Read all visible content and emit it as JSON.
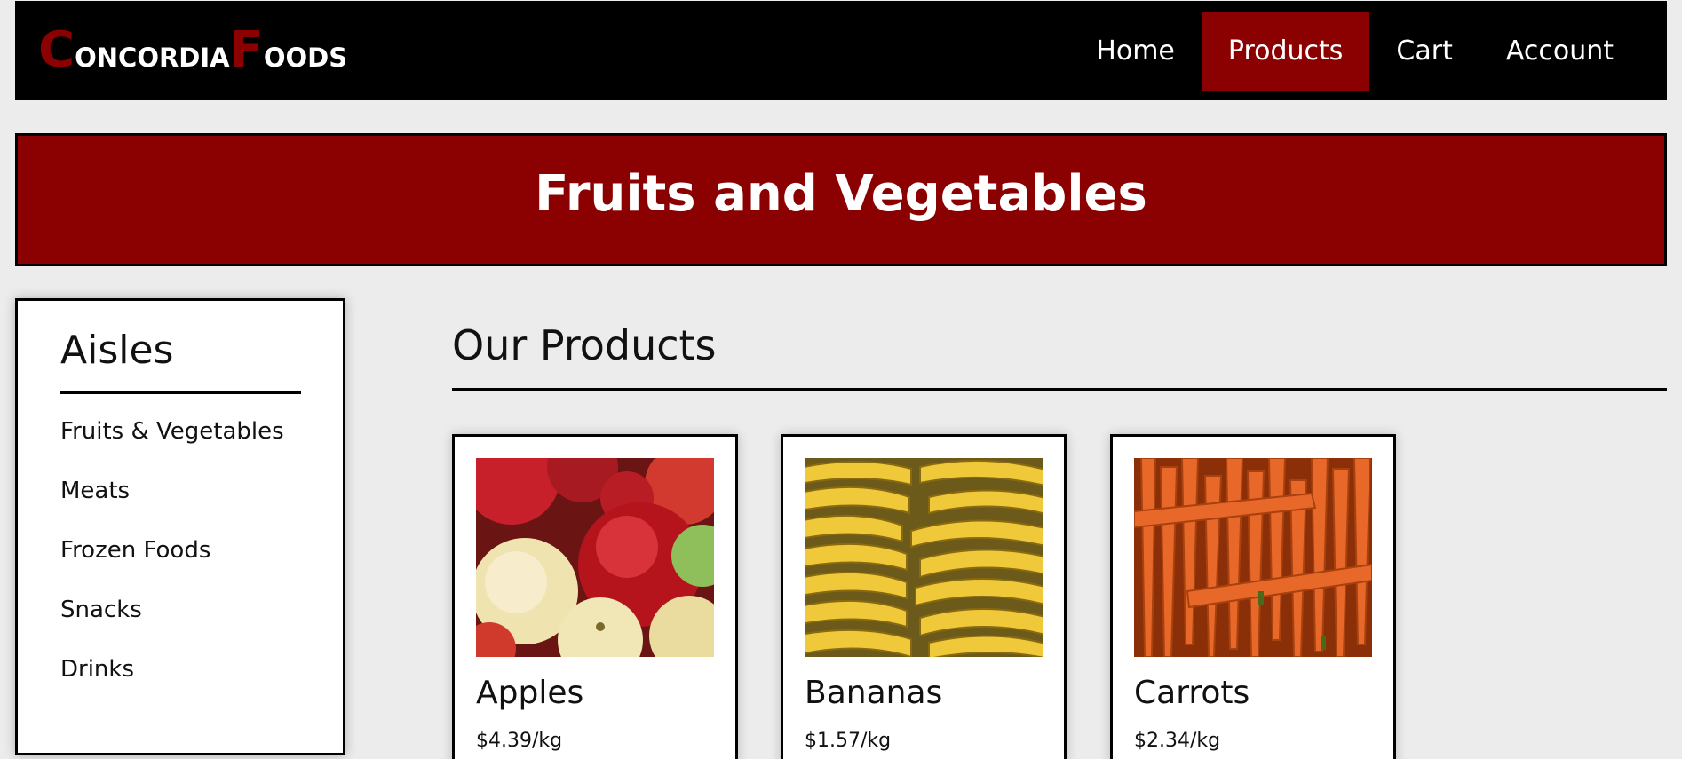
{
  "brand": {
    "parts": [
      {
        "cap": "C",
        "rest": "ONCORDIA"
      },
      {
        "cap": "F",
        "rest": "OODS"
      }
    ],
    "accent_color": "#8b0000"
  },
  "nav": {
    "links": [
      {
        "label": "Home",
        "active": false
      },
      {
        "label": "Products",
        "active": true
      },
      {
        "label": "Cart",
        "active": false
      },
      {
        "label": "Account",
        "active": false
      }
    ]
  },
  "banner": {
    "title": "Fruits and Vegetables"
  },
  "sidebar": {
    "title": "Aisles",
    "items": [
      {
        "label": "Fruits & Vegetables"
      },
      {
        "label": "Meats"
      },
      {
        "label": "Frozen Foods"
      },
      {
        "label": "Snacks"
      },
      {
        "label": "Drinks"
      }
    ]
  },
  "main": {
    "heading": "Our Products",
    "products": [
      {
        "name": "Apples",
        "price": "$4.39/kg",
        "image": "apples-photo"
      },
      {
        "name": "Bananas",
        "price": "$1.57/kg",
        "image": "bananas-photo"
      },
      {
        "name": "Carrots",
        "price": "$2.34/kg",
        "image": "carrots-photo"
      }
    ]
  }
}
